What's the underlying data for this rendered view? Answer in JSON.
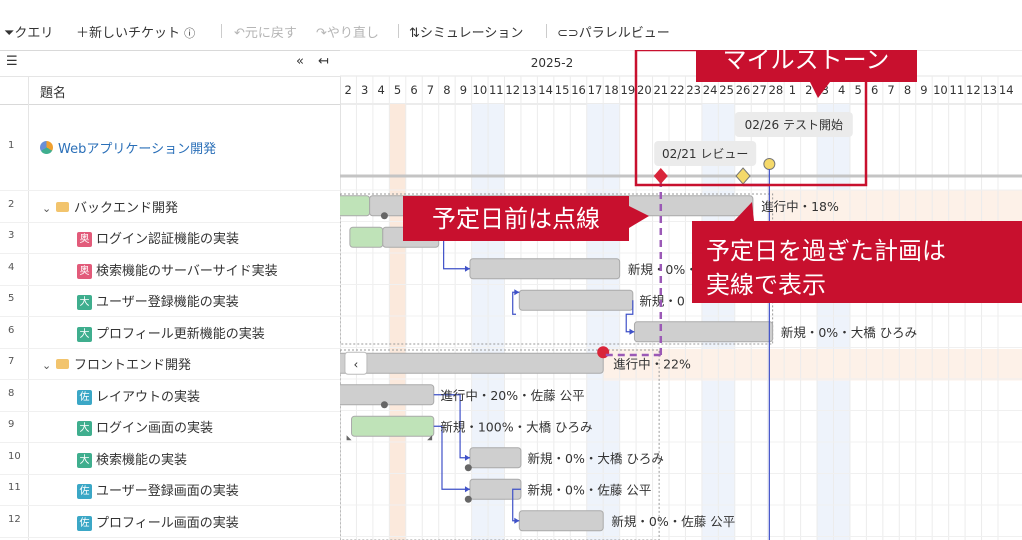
{
  "toolbar": {
    "query": "クエリ",
    "new_ticket": "新しいチケット",
    "undo": "元に戻す",
    "redo": "やり直し",
    "simulation": "シミュレーション",
    "parallel_view": "パラレルビュー"
  },
  "gantt": {
    "column_title": "題名",
    "month": "2025-2",
    "feb_days": [
      "2",
      "3",
      "4",
      "5",
      "6",
      "7",
      "8",
      "9",
      "10",
      "11",
      "12",
      "13",
      "14",
      "15",
      "16",
      "17",
      "18",
      "19",
      "20",
      "21",
      "22",
      "23",
      "24",
      "25",
      "26",
      "27",
      "28"
    ],
    "mar_days": [
      "1",
      "2",
      "3",
      "4",
      "5",
      "6",
      "7",
      "8",
      "9",
      "10",
      "11",
      "12",
      "13",
      "14"
    ]
  },
  "rows": [
    {
      "num": "1",
      "title": "Webアプリケーション開発",
      "kind": "project"
    },
    {
      "num": "2",
      "title": "バックエンド開発",
      "kind": "group"
    },
    {
      "num": "3",
      "title": "ログイン認証機能の実装",
      "kind": "task",
      "badge": "奥",
      "color": "#e25b7a"
    },
    {
      "num": "4",
      "title": "検索機能のサーバーサイド実装",
      "kind": "task",
      "badge": "奥",
      "color": "#e25b7a"
    },
    {
      "num": "5",
      "title": "ユーザー登録機能の実装",
      "kind": "task",
      "badge": "大",
      "color": "#3fae8e"
    },
    {
      "num": "6",
      "title": "プロフィール更新機能の実装",
      "kind": "task",
      "badge": "大",
      "color": "#3fae8e"
    },
    {
      "num": "7",
      "title": "フロントエンド開発",
      "kind": "group"
    },
    {
      "num": "8",
      "title": "レイアウトの実装",
      "kind": "task",
      "badge": "佐",
      "color": "#3ba7c6"
    },
    {
      "num": "9",
      "title": "ログイン画面の実装",
      "kind": "task",
      "badge": "大",
      "color": "#3fae8e"
    },
    {
      "num": "10",
      "title": "検索機能の実装",
      "kind": "task",
      "badge": "大",
      "color": "#3fae8e"
    },
    {
      "num": "11",
      "title": "ユーザー登録画面の実装",
      "kind": "task",
      "badge": "佐",
      "color": "#3ba7c6"
    },
    {
      "num": "12",
      "title": "プロフィール画面の実装",
      "kind": "task",
      "badge": "佐",
      "color": "#3ba7c6"
    }
  ],
  "bar_labels": {
    "r2": "進行中・18%",
    "r4": "新規・0%・",
    "r5": "新規・0",
    "r6": "新規・0%・大橋 ひろみ",
    "r7": "進行中・22%",
    "r8": "進行中・20%・佐藤 公平",
    "r9": "新規・100%・大橋 ひろみ",
    "r10": "新規・0%・大橋 ひろみ",
    "r11": "新規・0%・佐藤 公平",
    "r12": "新規・0%・佐藤 公平"
  },
  "milestones": {
    "review": "02/21 レビュー",
    "test_start": "02/26 テスト開始"
  },
  "callouts": {
    "milestone": "マイルストーン",
    "dashed": "予定日前は点線",
    "solid_line1": "予定日を過ぎた計画は",
    "solid_line2": "実線で表示"
  },
  "colors": {
    "link": "#2a6fb8",
    "callout_red": "#c8102e",
    "bar_gray": "#cfcfcf",
    "bar_green": "#bfe3b8",
    "dependency": "#3f51c8",
    "milestone_purple": "#9b59b6",
    "diamond_red": "#d9253a",
    "diamond_yellow": "#f5d96a"
  }
}
